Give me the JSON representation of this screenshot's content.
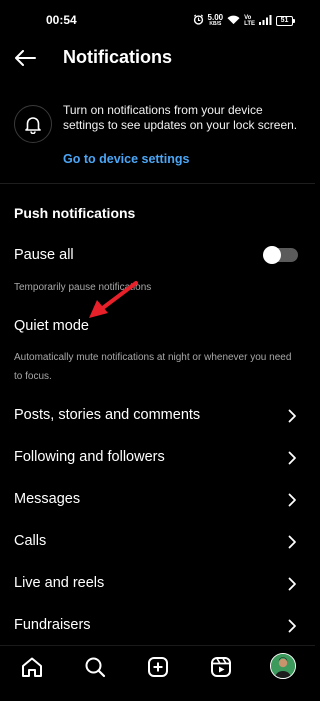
{
  "status_bar": {
    "time": "00:54",
    "net_speed_value": "5.00",
    "net_speed_unit": "KB/S",
    "volte_top": "Vo",
    "volte_bottom": "LTE",
    "battery": "51"
  },
  "header": {
    "title": "Notifications"
  },
  "banner": {
    "text": "Turn on notifications from your device settings to see updates on your lock screen.",
    "link": "Go to device settings"
  },
  "push": {
    "section_title": "Push notifications",
    "pause_all_label": "Pause all",
    "pause_all_desc": "Temporarily pause notifications",
    "pause_all_on": false,
    "quiet_mode_label": "Quiet mode",
    "quiet_mode_desc": "Automatically mute notifications at night or whenever you need to focus."
  },
  "rows": [
    {
      "label": "Posts, stories and comments"
    },
    {
      "label": "Following and followers"
    },
    {
      "label": "Messages"
    },
    {
      "label": "Calls"
    },
    {
      "label": "Live and reels"
    },
    {
      "label": "Fundraisers"
    }
  ],
  "colors": {
    "background": "#000000",
    "link": "#4ca6f5",
    "annotation_arrow": "#e8202a",
    "toggle_track_off": "#5b5b5b"
  },
  "bottom_nav": {
    "items": [
      "home-icon",
      "search-icon",
      "create-icon",
      "reels-icon",
      "profile-avatar"
    ]
  }
}
